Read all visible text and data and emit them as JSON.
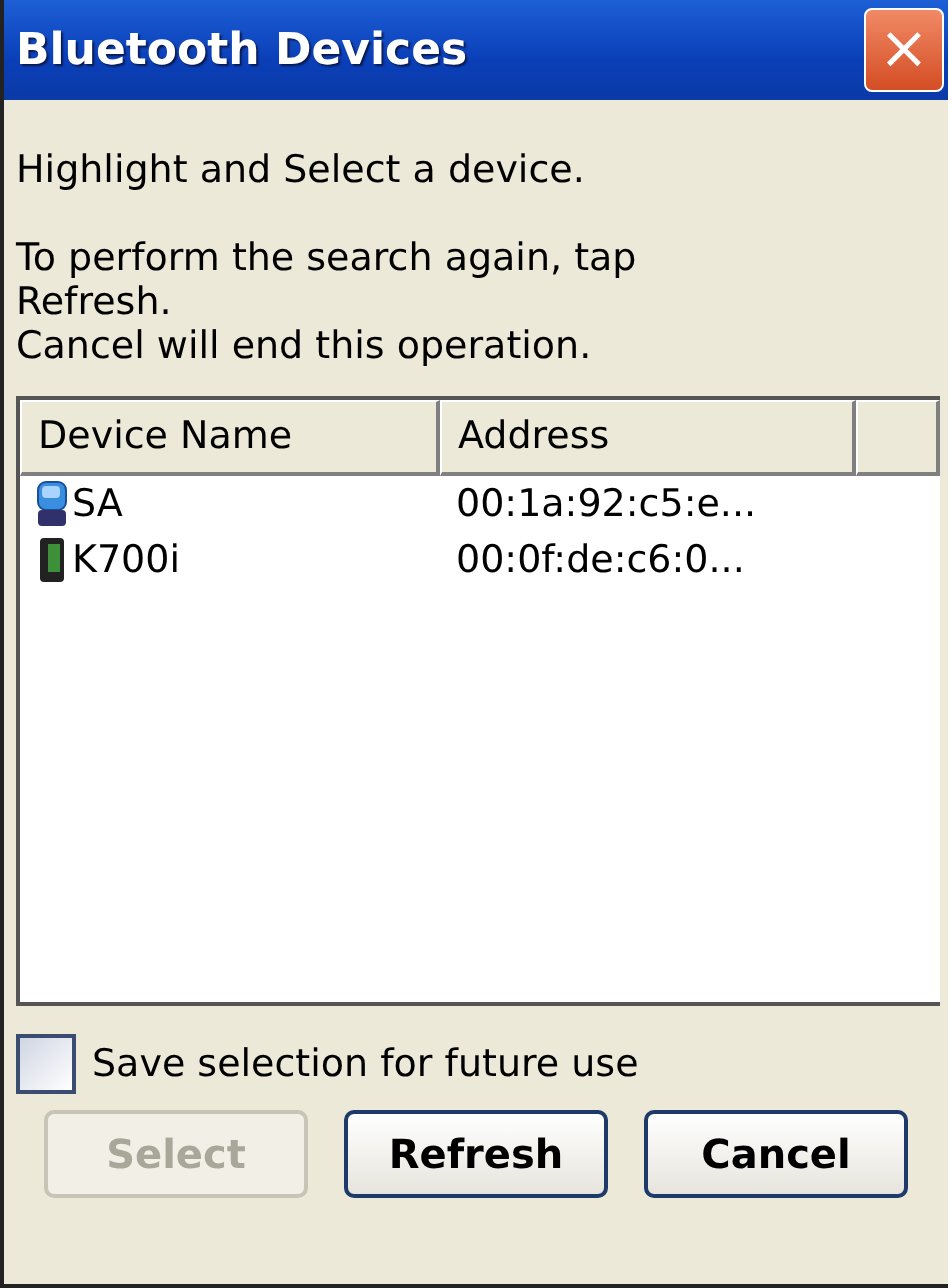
{
  "window": {
    "title": "Bluetooth Devices",
    "close": "×"
  },
  "messages": [
    "Highlight and Select a device.",
    "To perform the search again, tap\nRefresh.\nCancel will end this operation."
  ],
  "table": {
    "columns": [
      "Device Name",
      "Address"
    ],
    "rows": [
      {
        "kind": "computer",
        "name": "SA",
        "address": "00:1a:92:c5:e...",
        "selected": false
      },
      {
        "kind": "phone",
        "name": "K700i",
        "address": "00:0f:de:c6:0...",
        "selected": false
      }
    ]
  },
  "save_selection": {
    "label": "Save selection for future use",
    "checked": false
  },
  "buttons": [
    {
      "label": "Select",
      "disabled": true
    },
    {
      "label": "Refresh",
      "disabled": false
    },
    {
      "label": "Cancel",
      "disabled": false
    }
  ]
}
